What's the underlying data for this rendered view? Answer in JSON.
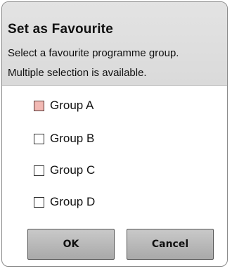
{
  "dialog": {
    "title": "Set as Favourite",
    "description_line1": "Select a favourite programme group.",
    "description_line2": "Multiple selection is available."
  },
  "options": [
    {
      "label": "Group A",
      "focused": true,
      "checked": false
    },
    {
      "label": "Group B",
      "focused": false,
      "checked": false
    },
    {
      "label": "Group C",
      "focused": false,
      "checked": false
    },
    {
      "label": "Group D",
      "focused": false,
      "checked": false
    }
  ],
  "buttons": {
    "ok_label": "OK",
    "cancel_label": "Cancel"
  },
  "colors": {
    "header_bg": "#dedede",
    "focus_box": "#f2b9b4",
    "button_bg": "#b9b9b9"
  }
}
